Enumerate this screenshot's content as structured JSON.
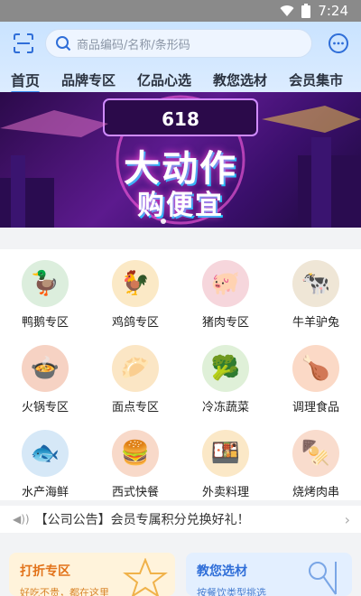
{
  "status": {
    "time": "7:24"
  },
  "header": {
    "search_placeholder": "商品编码/名称/条形码",
    "tabs": [
      {
        "label": "首页"
      },
      {
        "label": "品牌专区"
      },
      {
        "label": "亿品心选"
      },
      {
        "label": "教您选材"
      },
      {
        "label": "会员集市"
      }
    ]
  },
  "banner": {
    "line1": "618",
    "line2": "大动作",
    "line3": "购便宜"
  },
  "categories": [
    {
      "label": "鸭鹅专区",
      "icon": "duck-icon"
    },
    {
      "label": "鸡鸽专区",
      "icon": "chicken-icon"
    },
    {
      "label": "猪肉专区",
      "icon": "pig-icon"
    },
    {
      "label": "牛羊驴兔",
      "icon": "cow-icon"
    },
    {
      "label": "火锅专区",
      "icon": "hotpot-icon"
    },
    {
      "label": "面点专区",
      "icon": "bun-icon"
    },
    {
      "label": "冷冻蔬菜",
      "icon": "vegetable-icon"
    },
    {
      "label": "调理食品",
      "icon": "fried-chicken-icon"
    },
    {
      "label": "水产海鲜",
      "icon": "fish-icon"
    },
    {
      "label": "西式快餐",
      "icon": "burger-icon"
    },
    {
      "label": "外卖料理",
      "icon": "takeout-icon"
    },
    {
      "label": "烧烤肉串",
      "icon": "skewer-icon"
    }
  ],
  "notice": {
    "text": "【公司公告】会员专属积分兑换好礼！"
  },
  "promos": [
    {
      "title": "打折专区",
      "subtitle": "好吃不贵，都在这里"
    },
    {
      "title": "教您选材",
      "subtitle": "按餐饮类型挑选"
    }
  ]
}
